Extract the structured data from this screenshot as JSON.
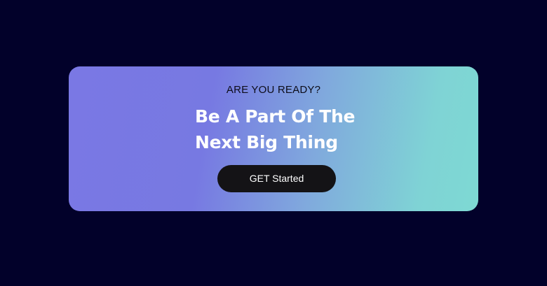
{
  "cta": {
    "eyebrow": "ARE YOU READY?",
    "headline_line1": "Be A Part Of The",
    "headline_line2": "Next Big Thing",
    "button_label": "GET Started"
  },
  "colors": {
    "page_background": "#02012a",
    "gradient_start": "#7a78e4",
    "gradient_end": "#7ed9d3",
    "button_background": "#141316",
    "button_text": "#ffffff",
    "headline_text": "#ffffff",
    "eyebrow_text": "#0d0d1a"
  }
}
